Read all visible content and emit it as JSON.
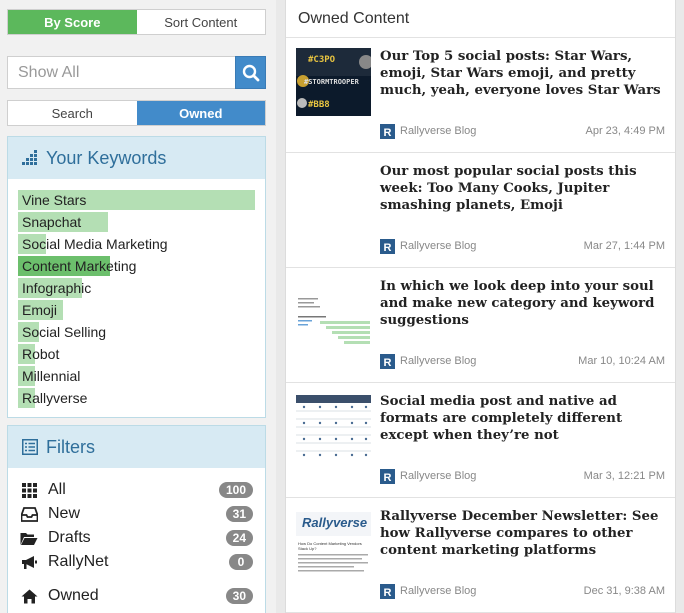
{
  "sort_tabs": {
    "by_score": "By Score",
    "sort_content": "Sort Content"
  },
  "search": {
    "placeholder": "Show All",
    "value": ""
  },
  "mode_tabs": {
    "search": "Search",
    "owned": "Owned"
  },
  "keywords_panel": {
    "title": "Your Keywords",
    "items": [
      {
        "label": "Vine Stars",
        "score": 1.0
      },
      {
        "label": "Snapchat",
        "score": 0.38
      },
      {
        "label": "Social Media Marketing",
        "score": 0.12
      },
      {
        "label": "Content Marketing",
        "score": 0.39
      },
      {
        "label": "Infographic",
        "score": 0.27
      },
      {
        "label": "Emoji",
        "score": 0.19
      },
      {
        "label": "Social Selling",
        "score": 0.09
      },
      {
        "label": "Robot",
        "score": 0.07
      },
      {
        "label": "Millennial",
        "score": 0.07
      },
      {
        "label": "Rallyverse",
        "score": 0.07
      }
    ]
  },
  "filters_panel": {
    "title": "Filters",
    "items": [
      {
        "label": "All",
        "count": "100",
        "icon": "grid-icon"
      },
      {
        "label": "New",
        "count": "31",
        "icon": "inbox-icon"
      },
      {
        "label": "Drafts",
        "count": "24",
        "icon": "folder-open-icon"
      },
      {
        "label": "RallyNet",
        "count": "0",
        "icon": "megaphone-icon"
      },
      {
        "label": "Owned",
        "count": "30",
        "icon": "home-icon"
      }
    ]
  },
  "content": {
    "title": "Owned Content",
    "items": [
      {
        "title": "Our Top 5 social posts: Star Wars, emoji, Star Wars emoji, and pretty much, yeah, everyone loves Star Wars",
        "source": "Rallyverse Blog",
        "date": "Apr 23, 4:49 PM",
        "thumb_tags": [
          "#C3PO",
          "#STORMTROOPER",
          "#BB8"
        ]
      },
      {
        "title": "Our most popular social posts this week: Too Many Cooks, Jupiter smashing planets, Emoji",
        "source": "Rallyverse Blog",
        "date": "Mar 27, 1:44 PM"
      },
      {
        "title": "In which we look deep into your soul and make new category and keyword suggestions",
        "source": "Rallyverse Blog",
        "date": "Mar 10, 10:24 AM"
      },
      {
        "title": "Social media post and native ad formats are completely different except when they’re not",
        "source": "Rallyverse Blog",
        "date": "Mar 3, 12:21 PM"
      },
      {
        "title": "Rallyverse December Newsletter: See how Rallyverse compares to other content marketing platforms",
        "source": "Rallyverse Blog",
        "date": "Dec 31, 9:38 AM",
        "thumb_brand": "Rallyverse",
        "thumb_heading": "How Do Content Marketing Vendors Stack Up?"
      }
    ]
  },
  "colors": {
    "green": "#5cb85c",
    "blue": "#428bca",
    "panel_head": "#d7eaf3",
    "keyword_bar": "#b4dfb4"
  }
}
